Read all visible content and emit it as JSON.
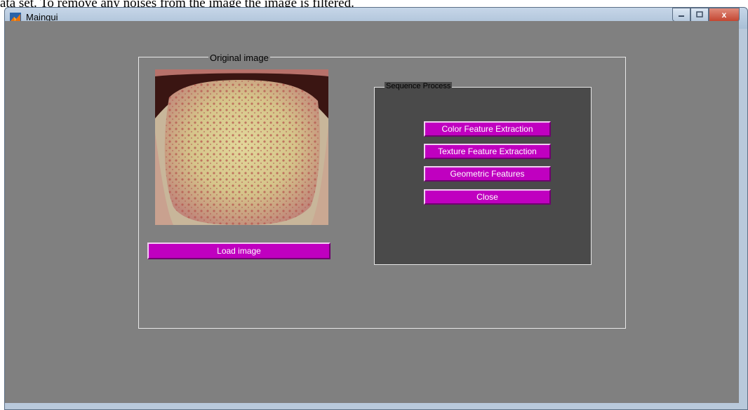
{
  "document": {
    "text_above": "ata set. To remove any noises from the image the image is filtered."
  },
  "window": {
    "title": "Maingui",
    "app_icon": "matlab-icon",
    "controls": {
      "minimize_icon": "minimize-icon",
      "maximize_icon": "maximize-icon",
      "close_glyph": "x"
    }
  },
  "original_image": {
    "title": "Original  image",
    "content": "tongue-photo"
  },
  "load_button": {
    "label": "Load  image"
  },
  "sequence_panel": {
    "title": "Sequence Process",
    "buttons": [
      {
        "label": "Color Feature Extraction"
      },
      {
        "label": "Texture Feature Extraction"
      },
      {
        "label": "Geometric Features"
      },
      {
        "label": "Close"
      }
    ]
  },
  "colors": {
    "background": "#808080",
    "button": "#c000c0",
    "panel": "#4a4a4a"
  }
}
